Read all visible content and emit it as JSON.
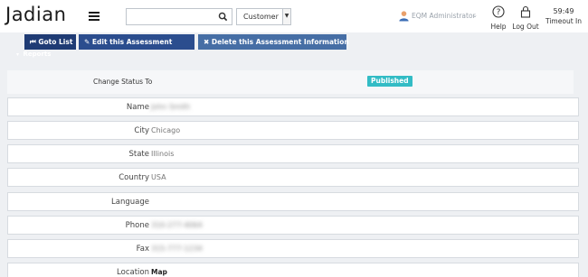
{
  "header": {
    "logo": "Jadian",
    "search": {
      "value": "",
      "placeholder": ""
    },
    "entity_select": {
      "selected": "Customer"
    },
    "user": {
      "name": "EQM Administrator"
    },
    "help_label": "Help",
    "logout_label": "Log Out",
    "timeout": {
      "time": "59:49",
      "label": "Timeout In"
    }
  },
  "toolbar": {
    "goto_list": "Goto List",
    "edit_assessment": "Edit this Assessment",
    "delete_assessment": "Delete this Assessment Information"
  },
  "reports_label": "Reports",
  "status": {
    "label": "Change Status To",
    "badge": "Published",
    "badge_color": "#33bcc5"
  },
  "fields": [
    {
      "label": "Name",
      "value": "John Smith"
    },
    {
      "label": "City",
      "value": "Chicago"
    },
    {
      "label": "State",
      "value": "Illinois"
    },
    {
      "label": "Country",
      "value": "USA"
    },
    {
      "label": "Language",
      "value": ""
    },
    {
      "label": "Phone",
      "value": "310-277-4064"
    },
    {
      "label": "Fax",
      "value": "315-777-1234"
    },
    {
      "label": "Location",
      "value": "Map"
    }
  ],
  "colors": {
    "goto_button": "#1f3b74",
    "edit_button": "#2b4d8e",
    "delete_button": "#466ea5"
  }
}
